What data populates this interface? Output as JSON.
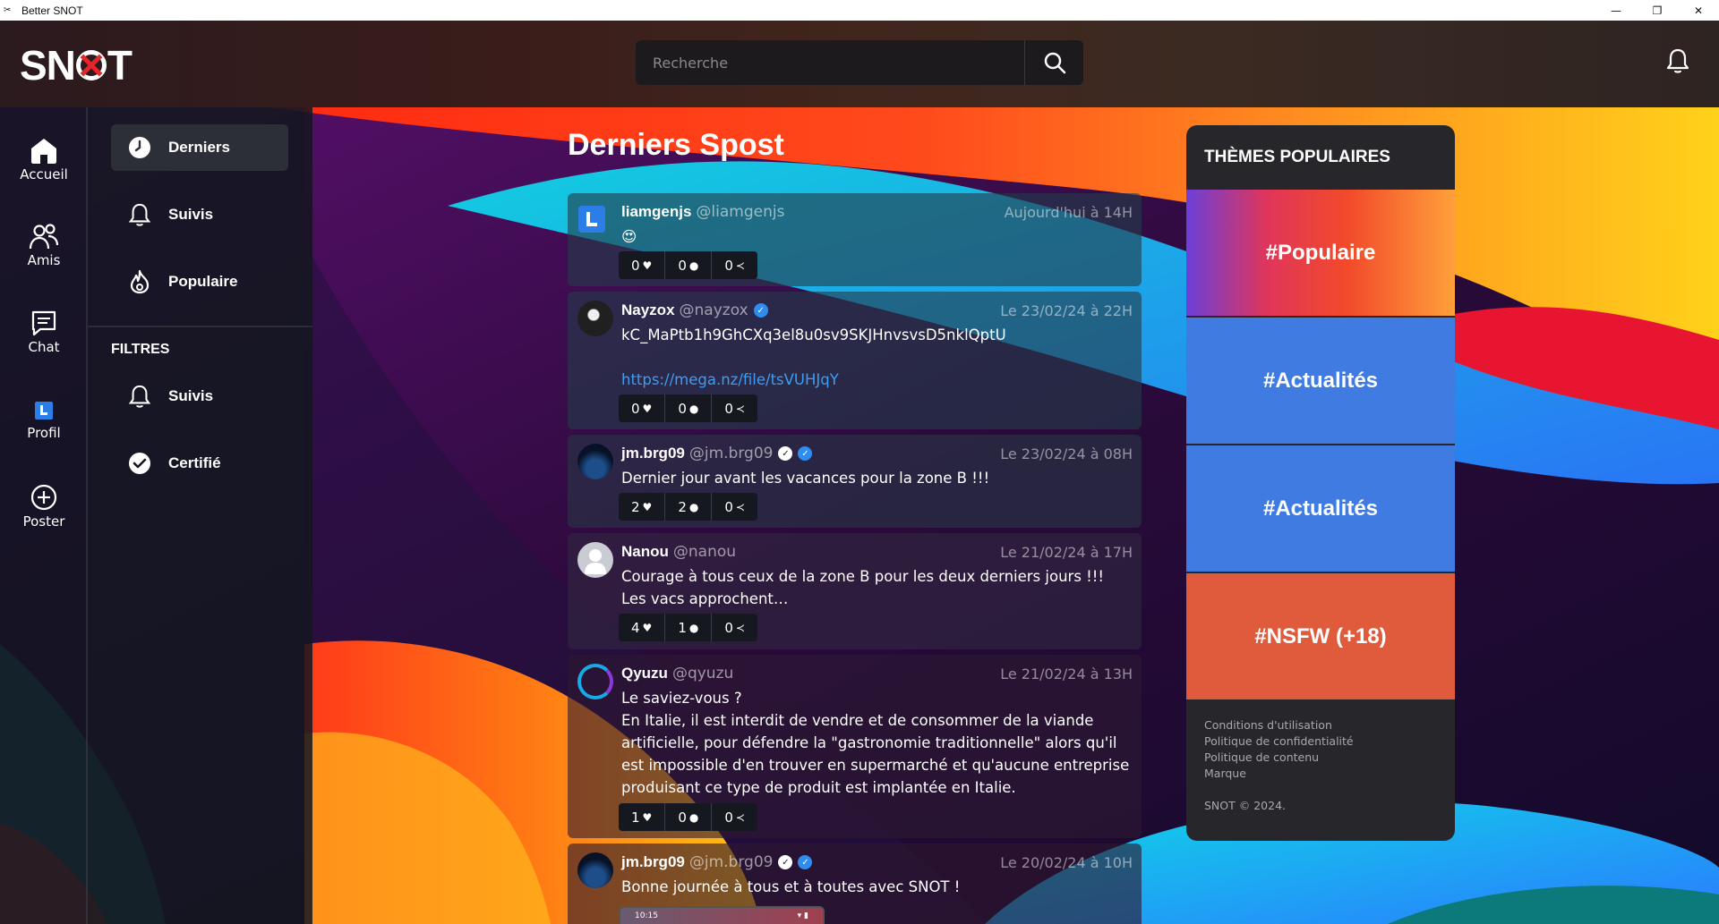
{
  "window": {
    "title": "Better SNOT",
    "controls": [
      "—",
      "❐",
      "✕"
    ]
  },
  "app": {
    "logo": "SNOT",
    "search_placeholder": "Recherche"
  },
  "nav": [
    {
      "label": "Accueil",
      "icon": "home-icon"
    },
    {
      "label": "Amis",
      "icon": "friends-icon"
    },
    {
      "label": "Chat",
      "icon": "chat-icon"
    },
    {
      "label": "Profil",
      "icon": "profile-icon"
    },
    {
      "label": "Poster",
      "icon": "add-post-icon"
    }
  ],
  "side": {
    "items": [
      {
        "label": "Derniers",
        "icon": "clock-icon"
      },
      {
        "label": "Suivis",
        "icon": "bell-icon"
      },
      {
        "label": "Populaire",
        "icon": "flame-icon"
      }
    ],
    "filters_heading": "FILTRES",
    "filters": [
      {
        "label": "Suivis",
        "icon": "bell-icon"
      },
      {
        "label": "Certifié",
        "icon": "check-circle-icon"
      }
    ]
  },
  "feed": {
    "title": "Derniers Spost",
    "posts": [
      {
        "name": "liamgenjs",
        "handle": "@liamgenjs",
        "date": "Aujourd'hui à 14H",
        "text": "😍",
        "likes": "0",
        "comments": "0",
        "shares": "0"
      },
      {
        "name": "Nayzox",
        "handle": "@nayzox",
        "date": "Le 23/02/24 à 22H",
        "text": "kC_MaPtb1h9GhCXq3el8u0sv9SKJHnvsvsD5nklQptU",
        "link": "https://mega.nz/file/tsVUHJqY",
        "likes": "0",
        "comments": "0",
        "shares": "0"
      },
      {
        "name": "jm.brg09",
        "handle": "@jm.brg09",
        "date": "Le 23/02/24 à 08H",
        "text": "Dernier jour avant les vacances pour la zone B !!!",
        "likes": "2",
        "comments": "2",
        "shares": "0"
      },
      {
        "name": "Nanou",
        "handle": "@nanou",
        "date": "Le 21/02/24 à 17H",
        "text": "Courage à tous ceux de la zone B pour les deux derniers jours !!! Les vacs approchent…",
        "likes": "4",
        "comments": "1",
        "shares": "0"
      },
      {
        "name": "Qyuzu",
        "handle": "@qyuzu",
        "date": "Le 21/02/24 à 13H",
        "text_line1": "Le saviez-vous ?",
        "text": "En Italie, il est interdit de vendre et de consommer de la viande artificielle, pour défendre la \"gastronomie traditionnelle\" alors qu'il est impossible d'en trouver en supermarché et qu'aucune entreprise produisant ce type de produit est implantée en Italie.",
        "likes": "1",
        "comments": "0",
        "shares": "0"
      },
      {
        "name": "jm.brg09",
        "handle": "@jm.brg09",
        "date": "Le 20/02/24 à 10H",
        "text": "Bonne journée à tous et à toutes avec SNOT !",
        "image_time": "10:15"
      }
    ]
  },
  "themes": {
    "title": "THÈMES POPULAIRES",
    "tiles": [
      "#Populaire",
      "#Actualités",
      "#Actualités",
      "#NSFW (+18)"
    ],
    "links": [
      "Conditions d'utilisation",
      "Politique de confidentialité",
      "Politique de contenu",
      "Marque"
    ],
    "copyright": "SNOT © 2024."
  },
  "colors": {
    "accent_blue": "#3d7be0",
    "nsfw_orange": "#e05a3c",
    "verified_blue": "#2f8df0"
  }
}
